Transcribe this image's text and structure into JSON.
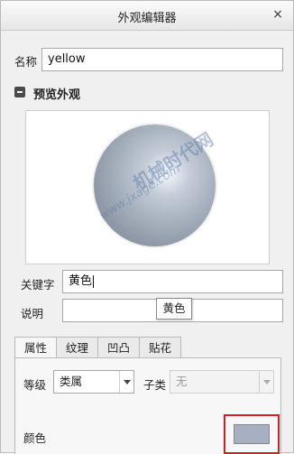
{
  "window": {
    "title": "外观编辑器",
    "close_glyph": "×"
  },
  "name_field": {
    "label": "名称",
    "value": "yellow"
  },
  "preview_section": {
    "title": "预览外观"
  },
  "watermark": {
    "line1": "机械时代网",
    "line2": "www.jxage.com"
  },
  "keyword_field": {
    "label": "关键字",
    "value": "黄色"
  },
  "description_field": {
    "label": "说明",
    "value": ""
  },
  "tooltip": {
    "text": "黄色"
  },
  "tabs": [
    {
      "label": "属性",
      "active": true
    },
    {
      "label": "纹理",
      "active": false
    },
    {
      "label": "凹凸",
      "active": false
    },
    {
      "label": "贴花",
      "active": false
    }
  ],
  "properties": {
    "grade_label": "等级",
    "grade_value": "类属",
    "subclass_label": "子类",
    "subclass_value": "无",
    "color_label": "颜色",
    "color_swatch": "#a6b0c1",
    "highlight_color": "#d42020"
  }
}
